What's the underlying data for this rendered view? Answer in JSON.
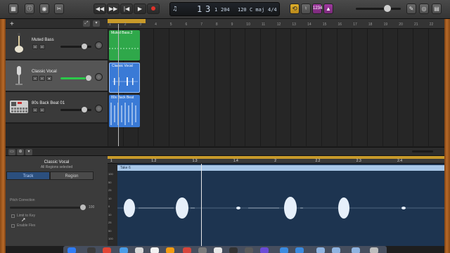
{
  "colors": {
    "region_bass": "#2fa84a",
    "region_vocal": "#3a7ad6",
    "region_beat": "#3a7ad6",
    "cycle": "#c89a2a",
    "editor_bg": "#1d3450"
  },
  "toolbar": {
    "library_icon": "library-icon",
    "info_icon": "info-icon",
    "smart_controls_icon": "smart-controls-icon",
    "editors_icon": "scissors-icon",
    "rewind": "◀◀",
    "forward": "▶▶",
    "to_start": "|◀",
    "play": "▶",
    "record": "record-icon"
  },
  "lcd": {
    "bar": "1",
    "beat": "3",
    "division": "1",
    "tick": "204",
    "tempo": "120",
    "key": "C maj",
    "signature": "4/4"
  },
  "right_controls": {
    "count_in": "1234"
  },
  "tracks": [
    {
      "name": "Muted Bass",
      "volume": 0.72,
      "selected": false
    },
    {
      "name": "Classic Vocal",
      "volume": 0.85,
      "selected": true
    },
    {
      "name": "80s Back Beat 01",
      "volume": 0.72,
      "selected": false
    }
  ],
  "ruler": {
    "bars": [
      "1",
      "2",
      "3",
      "4",
      "5",
      "6",
      "7",
      "8",
      "9",
      "10",
      "11",
      "12",
      "13",
      "14",
      "15",
      "16",
      "17",
      "18",
      "19",
      "20",
      "21",
      "22"
    ]
  },
  "regions": {
    "bass": "Muted Bass.2",
    "vocal": "Classic Vocal",
    "beat": "80s Back Beat"
  },
  "inspector": {
    "title": "Classic Vocal",
    "subtitle": "All Regions selected",
    "tab_track": "Track",
    "tab_region": "Region",
    "pitch_correction": "Pitch Correction",
    "pitch_value": "100",
    "limit_to_key": "Limit to Key",
    "enable_flex": "Enable Flex"
  },
  "editor": {
    "take_name": "Take 6",
    "ruler": [
      "1",
      "1.2",
      "1.3",
      "1.4",
      "2",
      "2.2",
      "2.3",
      "2.4"
    ],
    "db_scale": [
      "100",
      "50",
      "25",
      "10",
      "0",
      "10",
      "25",
      "50",
      "100"
    ]
  }
}
